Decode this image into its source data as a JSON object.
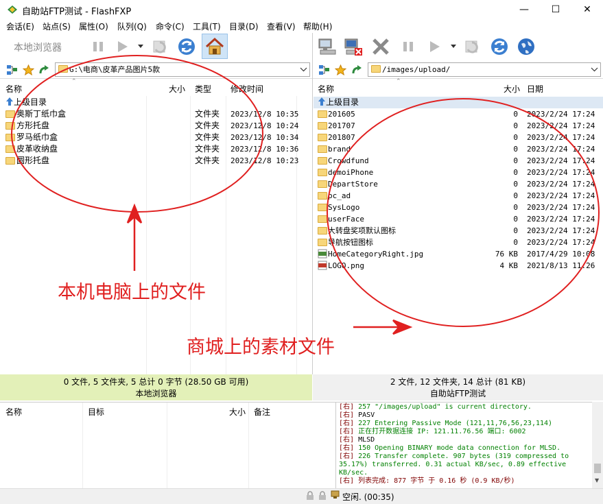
{
  "window": {
    "title": "自助站FTP测试 - FlashFXP"
  },
  "menu": [
    "会话(E)",
    "站点(S)",
    "属性(O)",
    "队列(Q)",
    "命令(C)",
    "工具(T)",
    "目录(D)",
    "查看(V)",
    "帮助(H)"
  ],
  "left": {
    "toolbar_label": "本地浏览器",
    "path": "G:\\电商\\皮革产品图片5款",
    "headers": {
      "name": "名称",
      "size": "大小",
      "type": "类型",
      "mtime": "修改时间"
    },
    "up": "上级目录",
    "rows": [
      {
        "name": "奥斯丁纸巾盒",
        "type": "文件夹",
        "mtime": "2023/12/8 10:35"
      },
      {
        "name": "方形托盘",
        "type": "文件夹",
        "mtime": "2023/12/8 10:24"
      },
      {
        "name": "罗马纸巾盒",
        "type": "文件夹",
        "mtime": "2023/12/8 10:34"
      },
      {
        "name": "皮革收纳盘",
        "type": "文件夹",
        "mtime": "2023/12/8 10:36"
      },
      {
        "name": "圆形托盘",
        "type": "文件夹",
        "mtime": "2023/12/8 10:23"
      }
    ],
    "status": "0 文件, 5 文件夹, 5 总计 0 字节 (28.50 GB 可用)",
    "panel_name": "本地浏览器",
    "annotation": "本机电脑上的文件"
  },
  "right": {
    "path": "/images/upload/",
    "headers": {
      "name": "名称",
      "size": "大小",
      "date": "日期"
    },
    "up": "上级目录",
    "rows": [
      {
        "name": "201605",
        "size": "0",
        "date": "2023/2/24 17:24",
        "kind": "folder"
      },
      {
        "name": "201707",
        "size": "0",
        "date": "2023/2/24 17:24",
        "kind": "folder"
      },
      {
        "name": "201807",
        "size": "0",
        "date": "2023/2/24 17:24",
        "kind": "folder"
      },
      {
        "name": "brand",
        "size": "0",
        "date": "2023/2/24 17:24",
        "kind": "folder"
      },
      {
        "name": "Crowdfund",
        "size": "0",
        "date": "2023/2/24 17:24",
        "kind": "folder"
      },
      {
        "name": "demoiPhone",
        "size": "0",
        "date": "2023/2/24 17:24",
        "kind": "folder"
      },
      {
        "name": "DepartStore",
        "size": "0",
        "date": "2023/2/24 17:24",
        "kind": "folder"
      },
      {
        "name": "pc_ad",
        "size": "0",
        "date": "2023/2/24 17:24",
        "kind": "folder"
      },
      {
        "name": "SysLogo",
        "size": "0",
        "date": "2023/2/24 17:24",
        "kind": "folder"
      },
      {
        "name": "userFace",
        "size": "0",
        "date": "2023/2/24 17:24",
        "kind": "folder"
      },
      {
        "name": "大转盘奖项默认图标",
        "size": "0",
        "date": "2023/2/24 17:24",
        "kind": "folder"
      },
      {
        "name": "导航按钮图标",
        "size": "0",
        "date": "2023/2/24 17:24",
        "kind": "folder"
      },
      {
        "name": "HomeCategoryRight.jpg",
        "size": "76 KB",
        "date": "2017/4/29 10:08",
        "kind": "jpg"
      },
      {
        "name": "LOGO.png",
        "size": "4 KB",
        "date": "2021/8/13 11:26",
        "kind": "png"
      }
    ],
    "status": "2 文件, 12 文件夹, 14 总计 (81 KB)",
    "panel_name": "自助站FTP测试",
    "annotation": "商城上的素材文件"
  },
  "queue": {
    "headers": {
      "name": "名称",
      "target": "目标",
      "size": "大小",
      "note": "备注"
    }
  },
  "log": [
    {
      "tag": "[右]",
      "text": "257 \"/images/upload\" is current directory.",
      "color": "#008000"
    },
    {
      "tag": "[右]",
      "text": "PASV",
      "color": "#000000"
    },
    {
      "tag": "[右]",
      "text": "227 Entering Passive Mode (121,11,76,56,23,114)",
      "color": "#008000"
    },
    {
      "tag": "[右]",
      "text": "正在打开数据连接 IP: 121.11.76.56 端口: 6002",
      "color": "#008000"
    },
    {
      "tag": "[右]",
      "text": "MLSD",
      "color": "#000000"
    },
    {
      "tag": "[右]",
      "text": "150 Opening BINARY mode data connection for MLSD.",
      "color": "#008000"
    },
    {
      "tag": "[右]",
      "text": "226 Transfer complete. 907 bytes (319 compressed to 35.17%) transferred. 0.31 actual KB/sec, 0.89 effective KB/sec.",
      "color": "#008000"
    },
    {
      "tag": "[右]",
      "text": "列表完成: 877 字节 于 0.16 秒 (0.9 KB/秒)",
      "color": "#800000"
    }
  ],
  "statusbar": {
    "text": "空闲. (00:35)"
  },
  "colors": {
    "annotation": "#e02020",
    "left_status_bg": "#e3f0b8"
  }
}
